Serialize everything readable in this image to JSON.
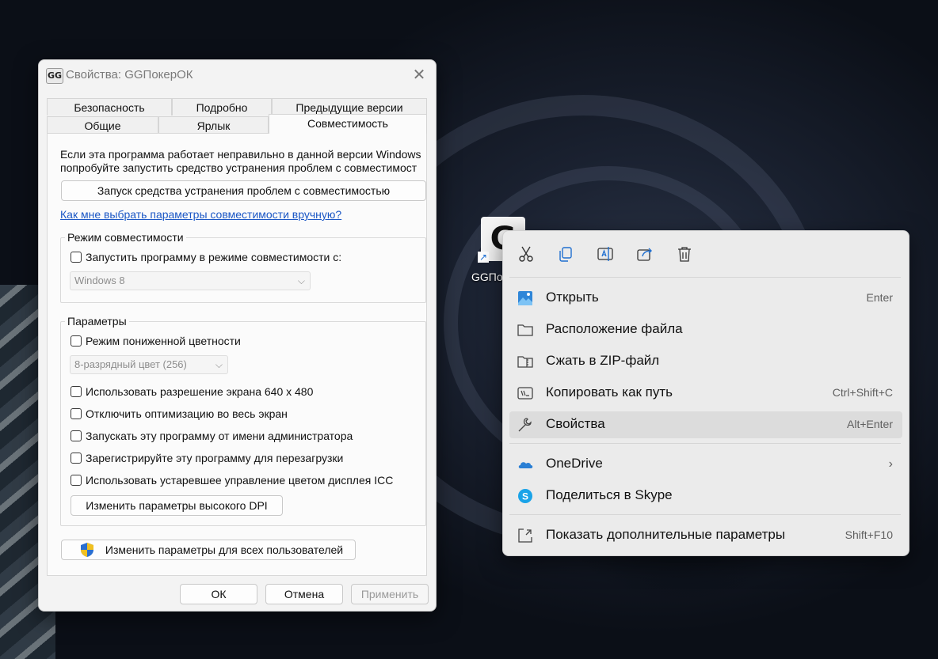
{
  "desktop": {
    "icon_label": "GGПо"
  },
  "dialog": {
    "title": "Свойства: GGПокерОК",
    "tabs": {
      "row1": [
        "Безопасность",
        "Подробно",
        "Предыдущие версии"
      ],
      "row2": [
        "Общие",
        "Ярлык",
        "Совместимость"
      ],
      "active": "Совместимость"
    },
    "intro_line1": "Если эта программа работает неправильно в данной версии Windows",
    "intro_line2": "попробуйте запустить средство устранения проблем с совместимост",
    "troubleshooter_button": "Запуск средства устранения проблем с совместимостью",
    "manual_link": "Как мне выбрать параметры совместимости вручную?",
    "compat_mode": {
      "legend": "Режим совместимости",
      "checkbox_label": "Запустить программу в режиме совместимости с:",
      "select_value": "Windows 8"
    },
    "settings": {
      "legend": "Параметры",
      "reduced_color_label": "Режим пониженной цветности",
      "color_select_value": "8-разрядный цвет (256)",
      "options": [
        "Использовать разрешение экрана 640 x 480",
        "Отключить оптимизацию во весь экран",
        "Запускать эту программу от имени администратора",
        "Зарегистрируйте эту программу для перезагрузки",
        "Использовать устаревшее управление цветом дисплея ICC"
      ],
      "dpi_button": "Изменить параметры высокого DPI"
    },
    "all_users_button": "Изменить параметры для всех пользователей",
    "ok": "ОК",
    "cancel": "Отмена",
    "apply": "Применить"
  },
  "context_menu": {
    "quick_actions": [
      "cut-icon",
      "copy-icon",
      "rename-icon",
      "share-icon",
      "delete-icon"
    ],
    "items": [
      {
        "label": "Открыть",
        "shortcut": "Enter",
        "icon": "image-icon"
      },
      {
        "label": "Расположение файла",
        "shortcut": "",
        "icon": "folder-icon"
      },
      {
        "label": "Сжать в ZIP-файл",
        "shortcut": "",
        "icon": "zip-folder-icon"
      },
      {
        "label": "Копировать как путь",
        "shortcut": "Ctrl+Shift+C",
        "icon": "copy-path-icon"
      },
      {
        "label": "Свойства",
        "shortcut": "Alt+Enter",
        "icon": "wrench-icon"
      },
      {
        "label": "OneDrive",
        "shortcut": "",
        "icon": "onedrive-icon"
      },
      {
        "label": "Поделиться в Skype",
        "shortcut": "",
        "icon": "skype-icon"
      },
      {
        "label": "Показать дополнительные параметры",
        "shortcut": "Shift+F10",
        "icon": "more-options-icon"
      }
    ],
    "hovered": "Свойства"
  },
  "colors": {
    "link": "#1b57c5",
    "onedrive": "#2a7fd4",
    "skype": "#1aa3e8"
  }
}
